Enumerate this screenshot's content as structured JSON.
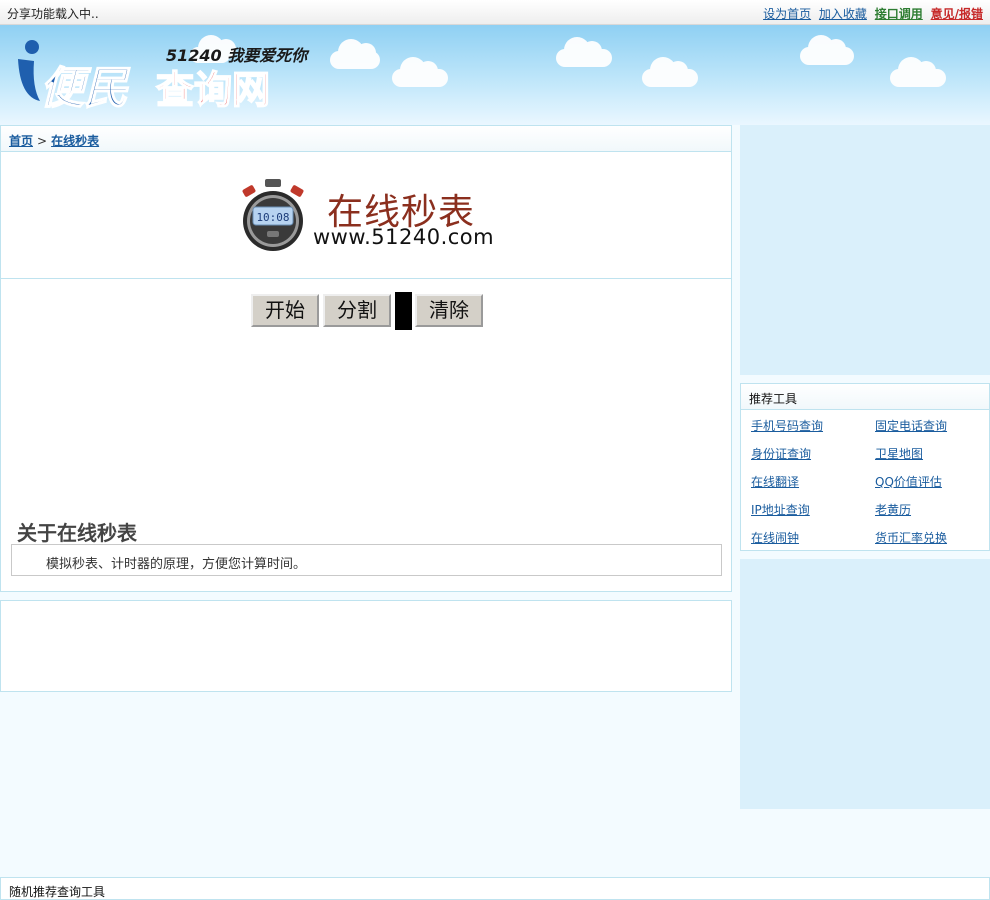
{
  "topbar": {
    "loading_text": "分享功能载入中..",
    "links": {
      "set_home": "设为首页",
      "bookmark": "加入收藏",
      "api": "接口调用",
      "report": "意见/报错"
    }
  },
  "logo": {
    "slogan": "51240 我要爱死你",
    "part1": "便民",
    "part2": "查询网"
  },
  "breadcrumb": {
    "home": "首页",
    "separator": ">",
    "current": "在线秒表"
  },
  "banner": {
    "title": "在线秒表",
    "url": "www.51240.com",
    "watch_time": "10:08"
  },
  "controls": {
    "start": "开始",
    "split": "分割",
    "clear": "清除"
  },
  "about": {
    "title": "关于在线秒表",
    "text": "模拟秒表、计时器的原理，方便您计算时间。"
  },
  "tools": {
    "title": "推荐工具",
    "items": [
      "手机号码查询",
      "固定电话查询",
      "身份证查询",
      "卫星地图",
      "在线翻译",
      "QQ价值评估",
      "IP地址查询",
      "老黄历",
      "在线闹钟",
      "货币汇率兑换"
    ]
  },
  "footer": {
    "random_tools_title": "随机推荐查询工具"
  },
  "colors": {
    "link": "#1a5c9e",
    "api_link": "#2e7d32",
    "report_link": "#c62828",
    "logo_blue": "#1f5fae",
    "logo_red": "#e3262b",
    "title_brown": "#8b2f1e"
  }
}
